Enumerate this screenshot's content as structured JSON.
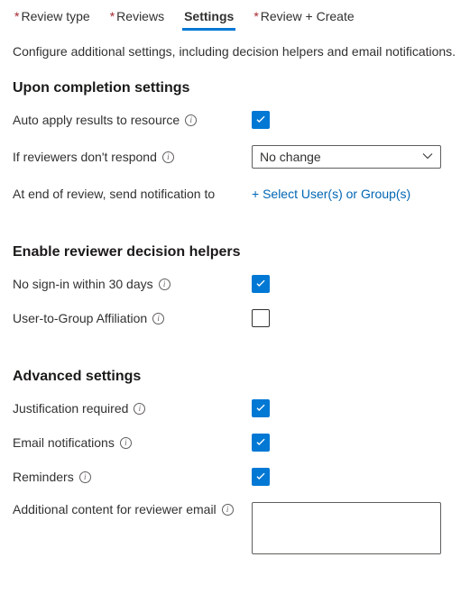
{
  "tabs": {
    "review_type": "Review type",
    "reviews": "Reviews",
    "settings": "Settings",
    "review_create": "Review + Create"
  },
  "intro": "Configure additional settings, including decision helpers and email notifications.",
  "sections": {
    "completion": {
      "title": "Upon completion settings",
      "auto_apply_label": "Auto apply results to resource",
      "auto_apply_checked": true,
      "no_respond_label": "If reviewers don't respond",
      "no_respond_value": "No change",
      "end_notify_label": "At end of review, send notification to",
      "select_users_link": "+ Select User(s) or Group(s)"
    },
    "helpers": {
      "title": "Enable reviewer decision helpers",
      "no_signin_label": "No sign-in within 30 days",
      "no_signin_checked": true,
      "affiliation_label": "User-to-Group Affiliation",
      "affiliation_checked": false
    },
    "advanced": {
      "title": "Advanced settings",
      "justification_label": "Justification required",
      "justification_checked": true,
      "email_label": "Email notifications",
      "email_checked": true,
      "reminders_label": "Reminders",
      "reminders_checked": true,
      "additional_content_label": "Additional content for reviewer email",
      "additional_content_value": ""
    }
  }
}
